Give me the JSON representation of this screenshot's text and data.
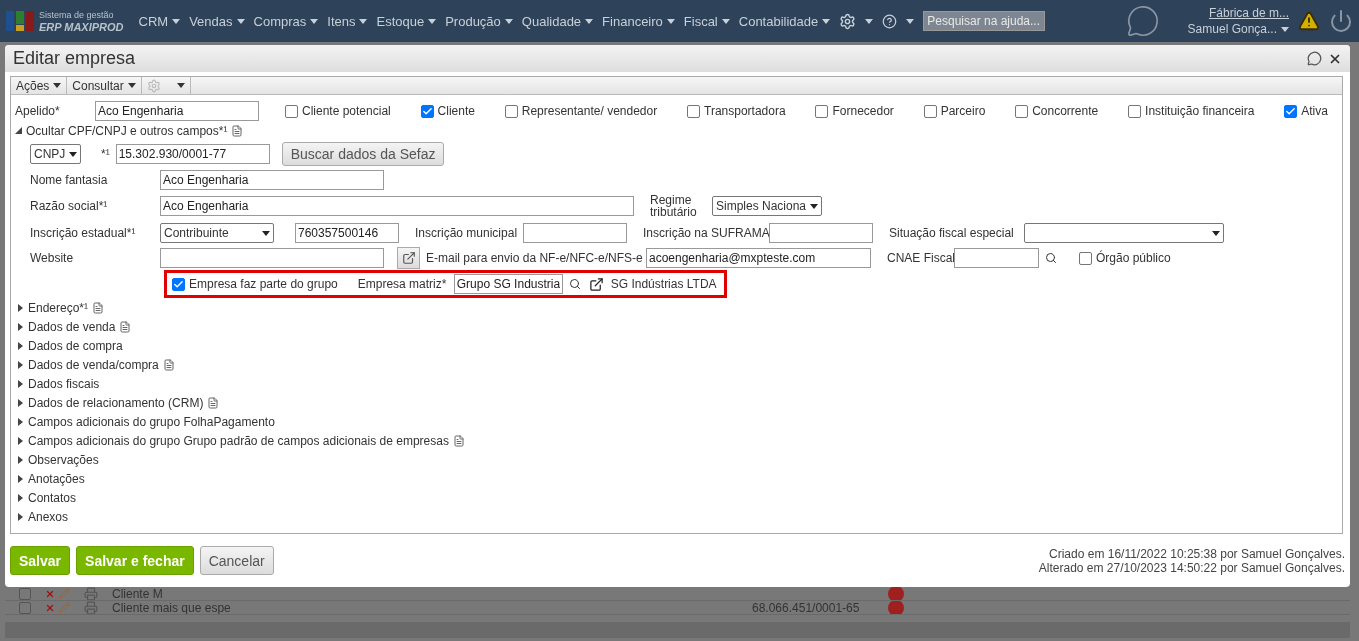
{
  "topbar": {
    "logo_line1": "Sistema de gestão",
    "logo_line2": "ERP MAXIPROD",
    "menus": [
      "CRM",
      "Vendas",
      "Compras",
      "Itens",
      "Estoque",
      "Produção",
      "Qualidade",
      "Financeiro",
      "Fiscal",
      "Contabilidade"
    ],
    "search": {
      "placeholder": "Pesquisar na ajuda..."
    },
    "company": "Fábrica de m...",
    "user": "Samuel Gonça..."
  },
  "dialog": {
    "title": "Editar empresa",
    "toolbar": [
      "Ações",
      "Consultar"
    ]
  },
  "form": {
    "apelido": {
      "label": "Apelido*",
      "value": "Aco Engenharia"
    },
    "roles": [
      {
        "label": "Cliente potencial",
        "checked": false
      },
      {
        "label": "Cliente",
        "checked": true
      },
      {
        "label": "Representante/ vendedor",
        "checked": false
      },
      {
        "label": "Transportadora",
        "checked": false
      },
      {
        "label": "Fornecedor",
        "checked": false
      },
      {
        "label": "Parceiro",
        "checked": false
      },
      {
        "label": "Concorrente",
        "checked": false
      },
      {
        "label": "Instituição financeira",
        "checked": false
      },
      {
        "label": "Ativa",
        "checked": true
      }
    ],
    "toggle": {
      "label": "Ocultar CPF/CNPJ e outros campos*¹",
      "expanded": true
    },
    "document": {
      "type": "CNPJ",
      "mark": "*¹",
      "value": "15.302.930/0001-77",
      "button": "Buscar dados da Sefaz"
    },
    "nome_fantasia": {
      "label": "Nome fantasia",
      "value": "Aco Engenharia"
    },
    "razao_social": {
      "label": "Razão social*¹",
      "value": "Aco Engenharia"
    },
    "regime": {
      "label": "Regime tributário",
      "value": "Simples Naciona"
    },
    "inscricao_estadual": {
      "label": "Inscrição estadual*¹",
      "type": "Contribuinte",
      "value": "760357500146"
    },
    "inscricao_municipal": {
      "label": "Inscrição municipal"
    },
    "suframa": {
      "label": "Inscrição na SUFRAMA"
    },
    "situacao_fiscal": {
      "label": "Situação fiscal especial"
    },
    "website": {
      "label": "Website"
    },
    "email": {
      "label": "E-mail para envio da NF-e/NFC-e/NFS-e",
      "value": "acoengenharia@mxpteste.com"
    },
    "cnae": {
      "label": "CNAE Fiscal"
    },
    "orgao_publico": {
      "label": "Órgão público",
      "checked": false
    },
    "group": {
      "checked": true,
      "label": "Empresa faz parte do grupo",
      "matriz_label": "Empresa matriz*",
      "matriz_value": "Grupo SG Industria",
      "matriz_name": "SG Indústrias LTDA"
    }
  },
  "sections": [
    {
      "label": "Endereço*¹",
      "expanded": false,
      "note_icon": true
    },
    {
      "label": "Dados de venda",
      "expanded": false,
      "note_icon": true
    },
    {
      "label": "Dados de compra",
      "expanded": false,
      "note_icon": false
    },
    {
      "label": "Dados de venda/compra",
      "expanded": false,
      "note_icon": true
    },
    {
      "label": "Dados fiscais",
      "expanded": false,
      "note_icon": false
    },
    {
      "label": "Dados de relacionamento (CRM)",
      "expanded": false,
      "note_icon": true
    },
    {
      "label": "Campos adicionais do grupo FolhaPagamento",
      "expanded": false,
      "note_icon": false
    },
    {
      "label": "Campos adicionais do grupo Grupo padrão de campos adicionais de empresas",
      "expanded": false,
      "note_icon": true
    },
    {
      "label": "Observações",
      "expanded": false,
      "note_icon": false
    },
    {
      "label": "Anotações",
      "expanded": false,
      "note_icon": false
    },
    {
      "label": "Contatos",
      "expanded": false,
      "note_icon": false
    },
    {
      "label": "Anexos",
      "expanded": false,
      "note_icon": false
    }
  ],
  "buttons": [
    {
      "label": "Salvar",
      "kind": "primary"
    },
    {
      "label": "Salvar e fechar",
      "kind": "primary"
    },
    {
      "label": "Cancelar",
      "kind": "secondary"
    }
  ],
  "audit": [
    "Criado em 16/11/2022 10:25:38 por Samuel Gonçalves.",
    "Alterado em 27/10/2023 14:50:22 por Samuel Gonçalves."
  ],
  "background_rows": [
    {
      "name": "Cliente M",
      "document": "",
      "checked": false
    },
    {
      "name": "Cliente mais que espe",
      "document": "68.066.451/0001-65",
      "checked": false
    }
  ]
}
